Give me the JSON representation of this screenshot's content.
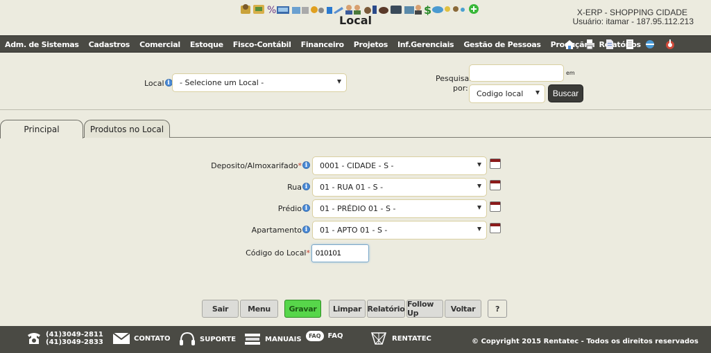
{
  "header": {
    "title": "Local",
    "system_name": "X-ERP - SHOPPING CIDADE",
    "user_info": "Usuário: itamar - 187.95.112.213"
  },
  "nav": {
    "items": [
      "Adm. de Sistemas",
      "Cadastros",
      "Comercial",
      "Estoque",
      "Fisco-Contábil",
      "Financeiro",
      "Projetos",
      "Inf.Gerenciais",
      "Gestão de Pessoas",
      "Produção",
      "Relatórios"
    ],
    "icons": [
      "home-icon",
      "print-icon",
      "document-icon",
      "page-icon",
      "network-icon",
      "logout-icon"
    ]
  },
  "search": {
    "local_label": "Local",
    "local_value": "- Selecione um Local -",
    "pesquisar_label": "Pesquisar",
    "por_label": "por:",
    "em_label": "em",
    "pesquisar_value": "",
    "tipo_value": "Codigo local",
    "buscar_label": "Buscar"
  },
  "tabs": {
    "principal": "Principal",
    "produtos": "Produtos no Local"
  },
  "form": {
    "deposito_label": "Deposito/Almoxarifado",
    "deposito_value": "0001 - CIDADE - S -",
    "rua_label": "Rua",
    "rua_value": "01 - RUA 01 - S -",
    "predio_label": "Prédio",
    "predio_value": "01 - PRÉDIO 01 - S -",
    "apartamento_label": "Apartamento",
    "apartamento_value": "01 - APTO 01 - S -",
    "codigo_label": "Código do Local",
    "codigo_value": "010101",
    "required_mark": "*"
  },
  "buttons": {
    "sair": "Sair",
    "menu": "Menu",
    "gravar": "Gravar",
    "limpar": "Limpar",
    "relatorio": "Relatório",
    "followup": "Follow Up",
    "voltar": "Voltar",
    "help": "?"
  },
  "footer": {
    "phone1": "(41)3049-2811",
    "phone2": "(41)3049-2833",
    "contato": "CONTATO",
    "suporte": "SUPORTE",
    "manuais": "MANUAIS",
    "faq": "FAQ",
    "faq_icon_text": "FAQ",
    "rentatec": "RENTATEC",
    "copyright": "© Copyright 2015 Rentatec - Todos os direitos reservados"
  },
  "info_glyph": "i",
  "colors": {
    "nav_bg": "#4a4a44",
    "page_bg": "#ecebdf",
    "accent_green": "#57d64a",
    "required_red": "#c0392b"
  }
}
